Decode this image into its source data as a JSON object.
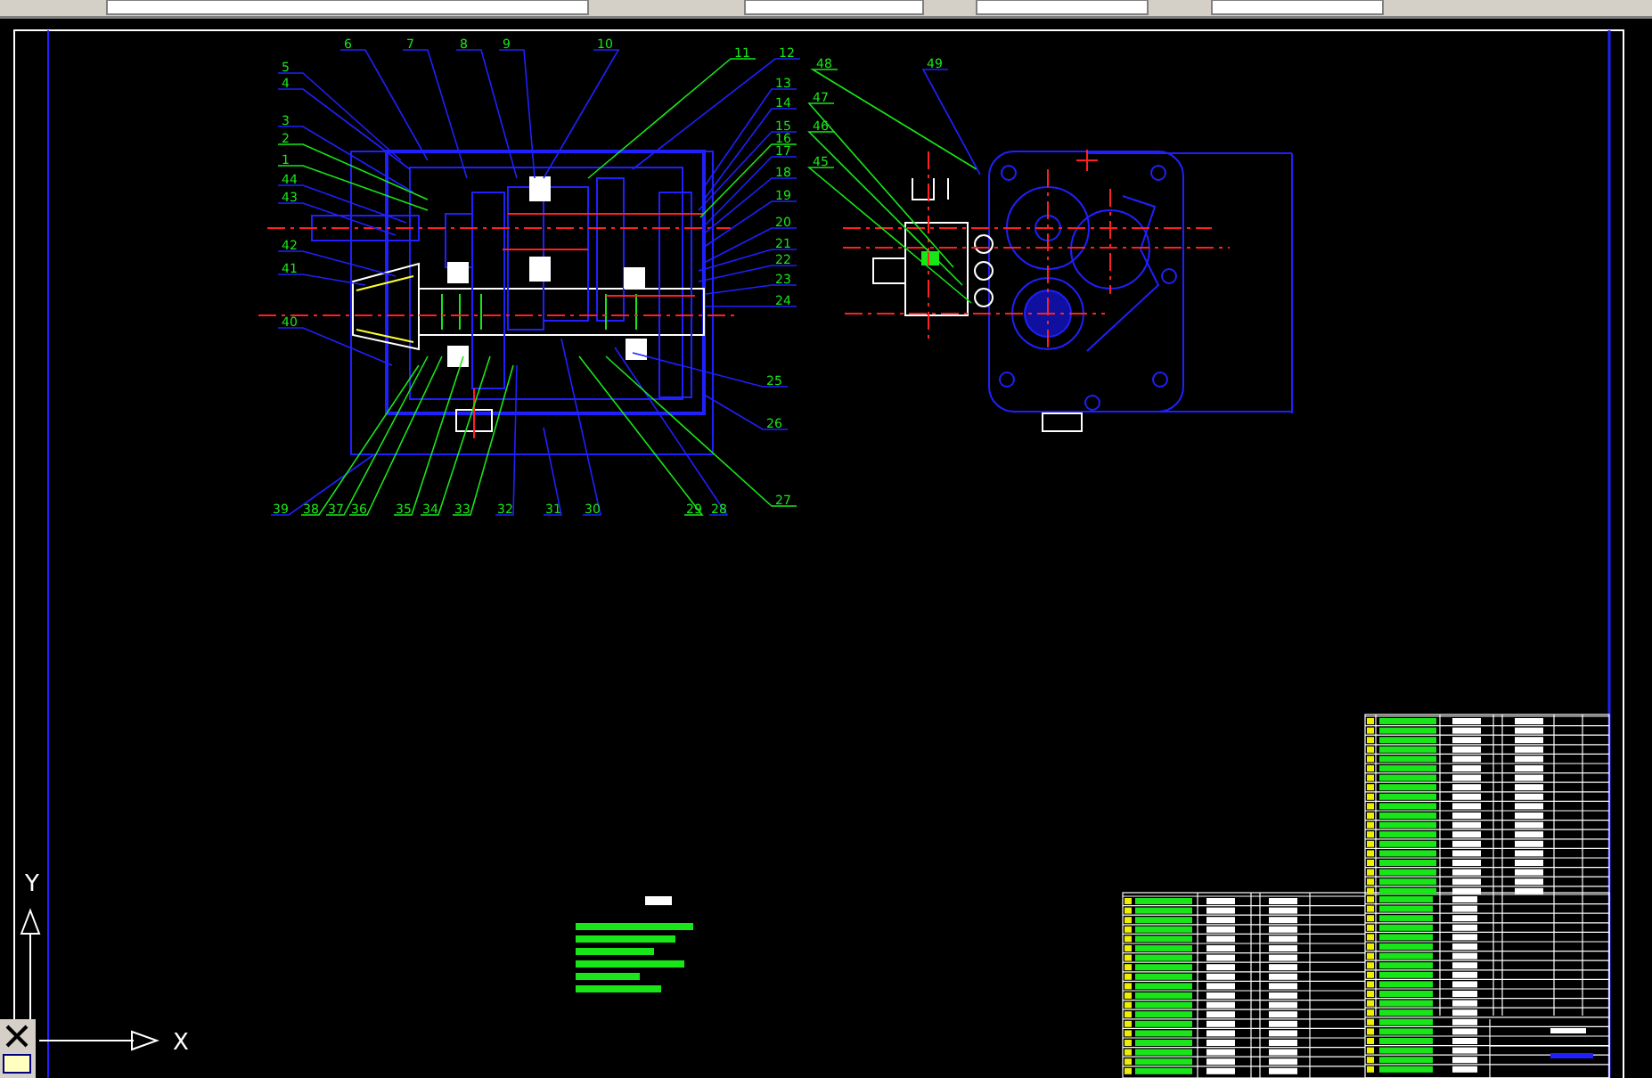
{
  "front_view_labels": [
    {
      "text": "6"
    },
    {
      "text": "7"
    },
    {
      "text": "8"
    },
    {
      "text": "9"
    },
    {
      "text": "10"
    },
    {
      "text": "11"
    },
    {
      "text": "12"
    },
    {
      "text": "13"
    },
    {
      "text": "14"
    },
    {
      "text": "15"
    },
    {
      "text": "16"
    },
    {
      "text": "17"
    },
    {
      "text": "18"
    },
    {
      "text": "19"
    },
    {
      "text": "20"
    },
    {
      "text": "21"
    },
    {
      "text": "22"
    },
    {
      "text": "23"
    },
    {
      "text": "24"
    },
    {
      "text": "25"
    },
    {
      "text": "26"
    },
    {
      "text": "39"
    },
    {
      "text": "38"
    },
    {
      "text": "37"
    },
    {
      "text": "36"
    },
    {
      "text": "35"
    },
    {
      "text": "34"
    },
    {
      "text": "33"
    },
    {
      "text": "32"
    },
    {
      "text": "31"
    },
    {
      "text": "30"
    },
    {
      "text": "29"
    },
    {
      "text": "28"
    },
    {
      "text": "27"
    },
    {
      "text": "5"
    },
    {
      "text": "4"
    },
    {
      "text": "3"
    },
    {
      "text": "2"
    },
    {
      "text": "1"
    },
    {
      "text": "44"
    },
    {
      "text": "43"
    },
    {
      "text": "42"
    },
    {
      "text": "41"
    },
    {
      "text": "40"
    }
  ],
  "side_view_labels": [
    {
      "text": "48"
    },
    {
      "text": "49"
    },
    {
      "text": "47"
    },
    {
      "text": "46"
    },
    {
      "text": "45"
    }
  ],
  "ucs": {
    "y_label": "Y",
    "x_label": "X"
  }
}
